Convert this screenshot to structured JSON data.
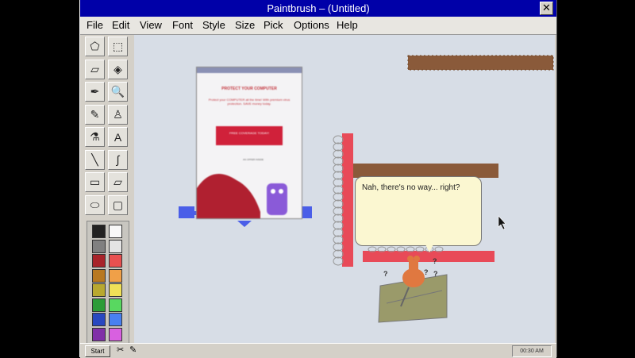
{
  "window": {
    "title": "Paintbrush – (Untitled)",
    "close_glyph": "✕"
  },
  "menu": [
    "File",
    "Edit",
    "View",
    "Font",
    "Style",
    "Size",
    "Pick",
    "Options",
    "Help"
  ],
  "tools": [
    {
      "name": "free-select-icon",
      "glyph": "⬠"
    },
    {
      "name": "rect-select-icon",
      "glyph": "⬚"
    },
    {
      "name": "eraser-icon",
      "glyph": "▱"
    },
    {
      "name": "fill-bucket-icon",
      "glyph": "◈"
    },
    {
      "name": "color-picker-icon",
      "glyph": "✒"
    },
    {
      "name": "magnifier-icon",
      "glyph": "🔍"
    },
    {
      "name": "pencil-icon",
      "glyph": "✎"
    },
    {
      "name": "brush-icon",
      "glyph": "♙"
    },
    {
      "name": "airbrush-icon",
      "glyph": "⚗"
    },
    {
      "name": "text-icon",
      "glyph": "A"
    },
    {
      "name": "line-icon",
      "glyph": "╲"
    },
    {
      "name": "curve-icon",
      "glyph": "∫"
    },
    {
      "name": "rectangle-icon",
      "glyph": "▭"
    },
    {
      "name": "polygon-icon",
      "glyph": "▱"
    },
    {
      "name": "ellipse-icon",
      "glyph": "⬭"
    },
    {
      "name": "rounded-rect-icon",
      "glyph": "▢"
    }
  ],
  "palette": [
    [
      "#222222",
      "#f8f8f8"
    ],
    [
      "#808080",
      "#e4e4e4"
    ],
    [
      "#a8242a",
      "#e85050"
    ],
    [
      "#b87820",
      "#f0a048"
    ],
    [
      "#b8a830",
      "#f0e058"
    ],
    [
      "#2c9c38",
      "#58d860"
    ],
    [
      "#2848c0",
      "#4880f0"
    ],
    [
      "#8030a8",
      "#d860e0"
    ]
  ],
  "ad": {
    "headline": "PROTECT YOUR COMPUTER",
    "body": "Protect your COMPUTER all the time! With premium virus protection. SAVE money today.",
    "button": "FREE COVERAGE TODAY!",
    "small": "AN OFFER INSIDE"
  },
  "bubble": {
    "text": "Nah, there's no way... right?"
  },
  "taskbar": {
    "start": "Start",
    "clock": "00:30 AM"
  },
  "colors": {
    "title_bar": "#0000a8",
    "canvas": "#d7dde6",
    "red_platform": "#e84a58",
    "brown_platform": "#8a5a3a",
    "blue_platform": "#4a5ee8",
    "bubble": "#fbf7d1",
    "pushpin": "#e07840"
  }
}
